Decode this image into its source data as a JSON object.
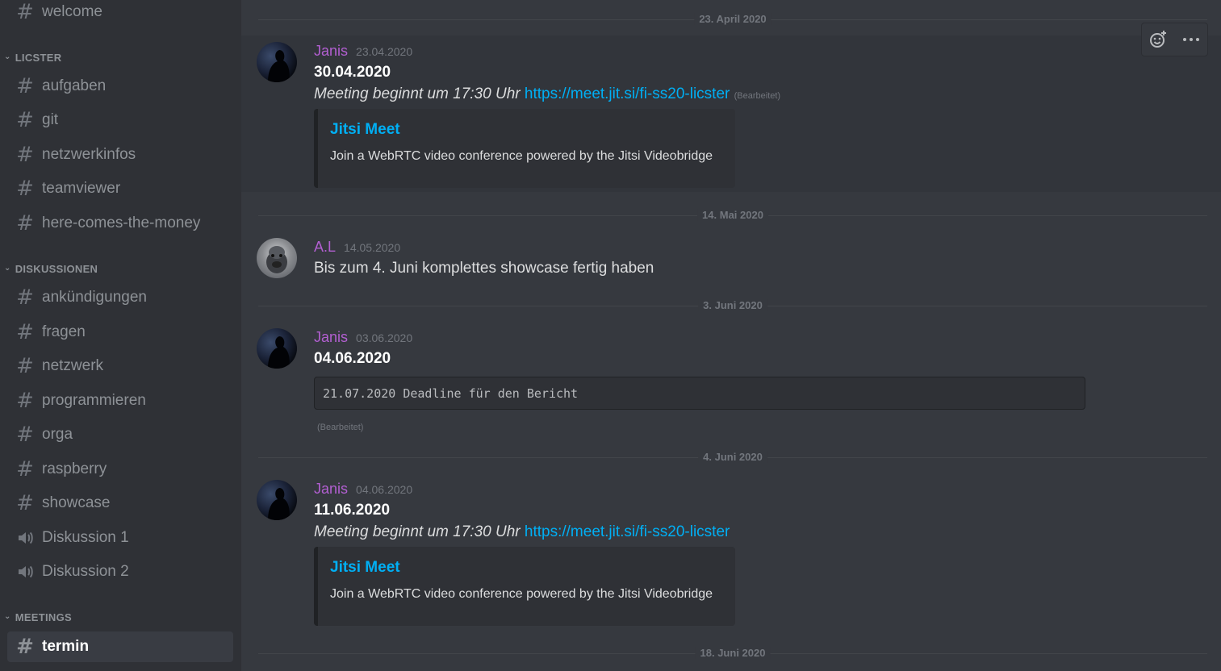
{
  "sidebar": {
    "top_channel": "welcome",
    "categories": [
      {
        "label": "LICSTER",
        "channels": [
          "aufgaben",
          "git",
          "netzwerkinfos",
          "teamviewer",
          "here-comes-the-money"
        ]
      },
      {
        "label": "DISKUSSIONEN",
        "channels": [
          "ankündigungen",
          "fragen",
          "netzwerk",
          "programmieren",
          "orga",
          "raspberry",
          "showcase"
        ],
        "voice": [
          "Diskussion 1",
          "Diskussion 2"
        ]
      },
      {
        "label": "MEETINGS",
        "channels": [
          "termin"
        ]
      }
    ],
    "active_channel": "termin"
  },
  "dividers": [
    "23. April 2020",
    "14. Mai 2020",
    "3. Juni 2020",
    "4. Juni 2020",
    "18. Juni 2020"
  ],
  "messages": [
    {
      "author": "Janis",
      "timestamp": "23.04.2020",
      "line1": "30.04.2020",
      "line2_text": "Meeting beginnt um 17:30 Uhr ",
      "link": "https://meet.jit.si/fi-ss20-licster",
      "edited": "(Bearbeitet)",
      "embed": {
        "title": "Jitsi Meet",
        "description": "Join a WebRTC video conference powered by the Jitsi Videobridge"
      }
    },
    {
      "author": "A.L",
      "timestamp": "14.05.2020",
      "text": "Bis zum 4. Juni komplettes showcase fertig haben"
    },
    {
      "author": "Janis",
      "timestamp": "03.06.2020",
      "line1": "04.06.2020",
      "code": "21.07.2020 Deadline für den Bericht",
      "edited": "(Bearbeitet)"
    },
    {
      "author": "Janis",
      "timestamp": "04.06.2020",
      "line1": "11.06.2020",
      "line2_text": "Meeting beginnt um 17:30 Uhr ",
      "link": "https://meet.jit.si/fi-ss20-licster",
      "embed": {
        "title": "Jitsi Meet",
        "description": "Join a WebRTC video conference powered by the Jitsi Videobridge"
      }
    }
  ],
  "colors": {
    "author": "#b25fd1",
    "link": "#00aff4",
    "sidebar_bg": "#2f3136",
    "main_bg": "#36393f"
  }
}
